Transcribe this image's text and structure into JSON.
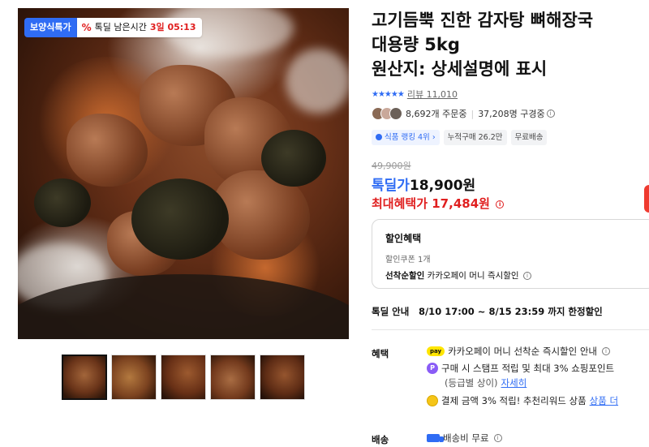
{
  "gallery": {
    "badge_special": "보양식특가",
    "badge_timer_label": "톡딜 남은시간",
    "badge_timer_value": "3일 05:13",
    "thumbnail_count": 5
  },
  "product": {
    "title_line1": "고기듬뿍 진한 감자탕 뼈해장국",
    "title_line2": "대용량 5kg",
    "title_line3": "원산지: 상세설명에 표시",
    "rating_stars": "★★★★★",
    "rating_value": 5,
    "review_label": "리뷰 11,010",
    "orders": "8,692개 주문중",
    "subscribers": "37,208명 구경중",
    "chip_rank": "식품 랭킹 4위",
    "chip_rank_arrow": "›",
    "chip_cumulative": "누적구매 26.2만",
    "chip_delivery": "무료배송"
  },
  "price": {
    "original": "49,900원",
    "deal_label": "톡딜가",
    "deal_value": "18,900원",
    "max_label": "최대혜택가",
    "max_value": "17,484원"
  },
  "discount_box": {
    "title": "할인혜택",
    "coupon": "할인쿠폰 1개",
    "first_come_label": "선착순할인",
    "first_come_desc": "카카오페이 머니 즉시할인"
  },
  "deal_info": {
    "label": "톡딜 안내",
    "period": "8/10 17:00 ~ 8/15 23:59 까지 한정할인"
  },
  "benefits": {
    "label": "혜택",
    "item1": "카카오페이 머니 선착순 즉시할인 안내",
    "item2": "구매 시 스탬프 적립 및 최대 3% 쇼핑포인트",
    "item2_sub": "(등급별 상이)",
    "item2_link": "자세히",
    "item3": "결제 금액 3% 적립! 추천리워드 상품",
    "item3_link": "상품 더"
  },
  "delivery": {
    "label": "배송",
    "text": "배송비 무료"
  },
  "icons": {
    "pay_icon_text": "pay",
    "p_icon_text": "P",
    "info_icon_text": "i",
    "percent_icon_text": "%"
  },
  "colors": {
    "brand_blue": "#2f6cf4",
    "accent_red": "#e02020"
  }
}
